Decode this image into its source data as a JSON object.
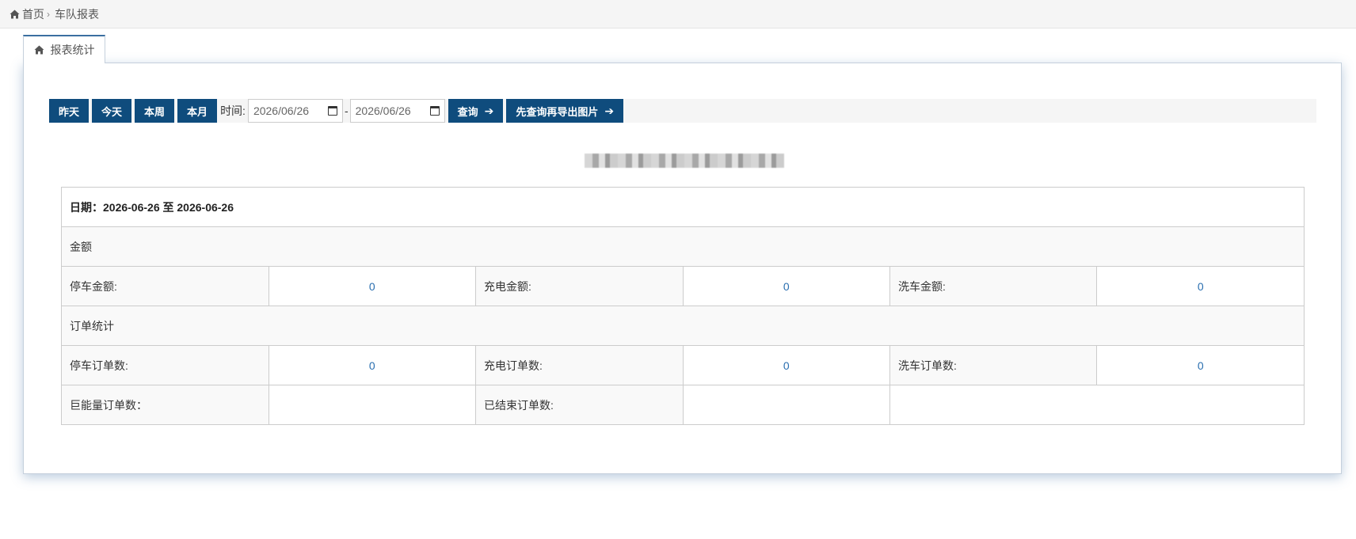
{
  "breadcrumb": {
    "home": "首页",
    "separator": "›",
    "current": "车队报表"
  },
  "tab": {
    "label": "报表统计"
  },
  "toolbar": {
    "yesterday": "昨天",
    "today": "今天",
    "this_week": "本周",
    "this_month": "本月",
    "time_label": "时间:",
    "start_date": "2026/06/26",
    "date_separator": "-",
    "end_date": "2026/06/26",
    "query": "查询",
    "export": "先查询再导出图片",
    "arrow": "➔"
  },
  "report": {
    "date_line": "日期：2026-06-26 至 2026-06-26",
    "amount_section": "金额",
    "parking_amount_label": "停车金额:",
    "parking_amount": "0",
    "charging_amount_label": "充电金额:",
    "charging_amount": "0",
    "washing_amount_label": "洗车金额:",
    "washing_amount": "0",
    "order_section": "订单统计",
    "parking_orders_label": "停车订单数:",
    "parking_orders": "0",
    "charging_orders_label": "充电订单数:",
    "charging_orders": "0",
    "washing_orders_label": "洗车订单数:",
    "washing_orders": "0",
    "juneng_orders_label": "巨能量订单数：",
    "juneng_orders": "",
    "finished_orders_label": "已结束订单数:",
    "finished_orders": ""
  },
  "colors": {
    "primary": "#0f4c7d",
    "value_text": "#2a6fb0",
    "tab_top": "#3b6fa0"
  }
}
